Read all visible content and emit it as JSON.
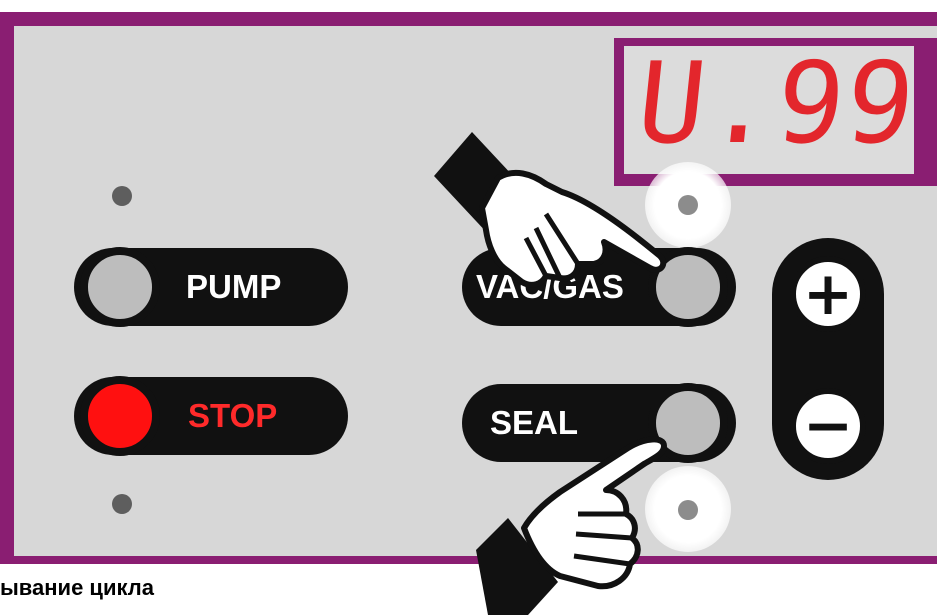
{
  "display": {
    "value": "U.99"
  },
  "buttons": {
    "pump_label": "PUMP",
    "stop_label": "STOP",
    "vac_gas_label": "VAC/GAS",
    "seal_label": "SEAL",
    "plus_label": "+",
    "minus_label": "−"
  },
  "caption": "ывание цикла",
  "colors": {
    "frame": "#8a1e72",
    "panel": "#d7d7d7",
    "display_digits": "#e3262c",
    "stop_red": "#ff1010"
  },
  "icons": [
    "pointing-hand-icon",
    "pointing-hand-icon"
  ]
}
